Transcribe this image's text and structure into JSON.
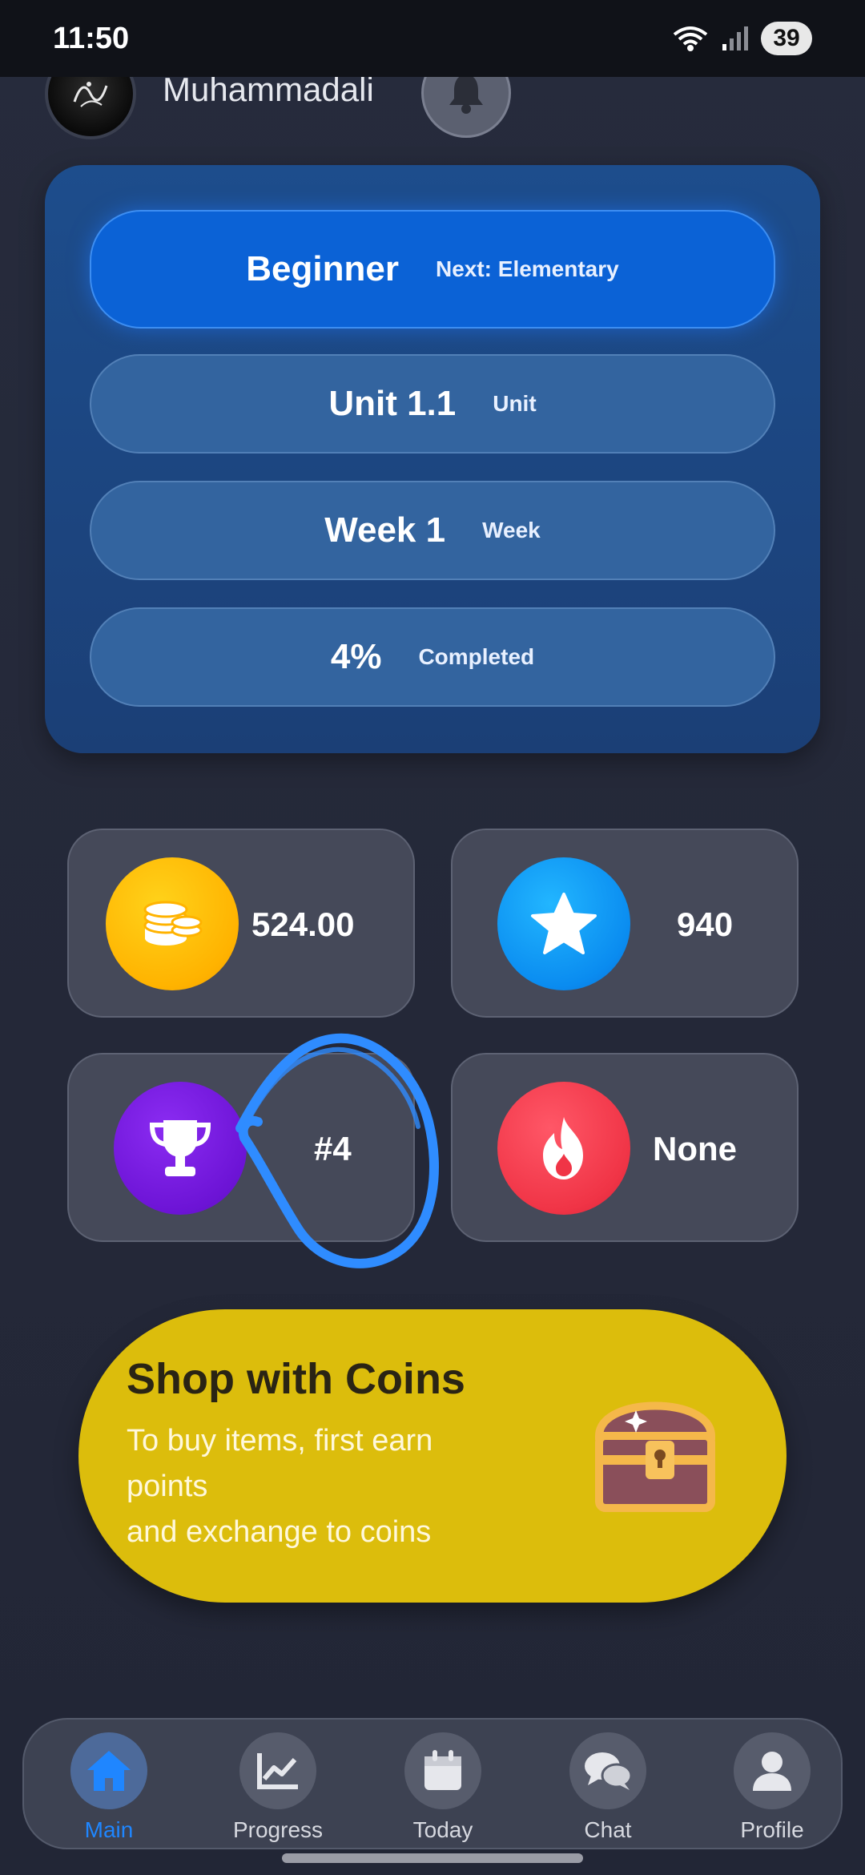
{
  "status_bar": {
    "time": "11:50",
    "battery": "39"
  },
  "header": {
    "user_name": "Muhammadali"
  },
  "level_card": {
    "level": "Beginner",
    "next_level": "Next: Elementary",
    "unit_value": "Unit 1.1",
    "unit_label": "Unit",
    "week_value": "Week 1",
    "week_label": "Week",
    "progress_value": "4%",
    "progress_label": "Completed"
  },
  "stats": {
    "coins": "524.00",
    "stars": "940",
    "rank": "#4",
    "streak": "None"
  },
  "shop": {
    "title": "Shop with Coins",
    "desc_line1": "To buy items, first earn",
    "desc_line2": "points",
    "desc_line3": "and exchange to coins"
  },
  "nav": {
    "items": [
      {
        "label": "Main",
        "icon": "home-icon",
        "active": true
      },
      {
        "label": "Progress",
        "icon": "chart-icon",
        "active": false
      },
      {
        "label": "Today",
        "icon": "calendar-icon",
        "active": false
      },
      {
        "label": "Chat",
        "icon": "chat-icon",
        "active": false
      },
      {
        "label": "Profile",
        "icon": "profile-icon",
        "active": false
      }
    ]
  },
  "colors": {
    "background": "#252a3a",
    "level_active": "#0b62d6",
    "pill": "#33649f",
    "coins": "#ffb300",
    "stars": "#0a8cf0",
    "rank": "#6d14d6",
    "streak": "#f03446",
    "shop": "#dcbd0c",
    "nav_active": "#1f86ff",
    "annotation": "#2f8cff"
  }
}
